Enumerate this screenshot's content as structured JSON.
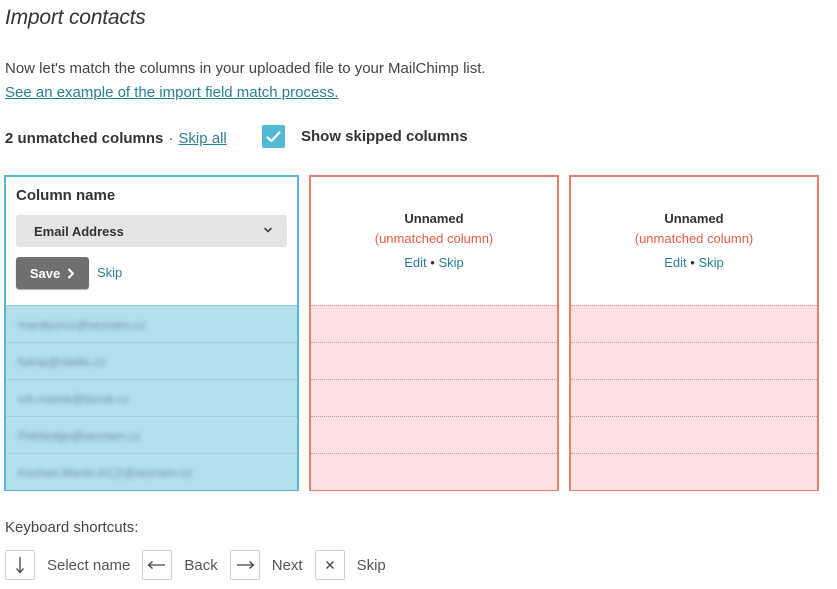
{
  "page": {
    "title": "Import contacts",
    "intro": "Now let's match the columns in your uploaded file to your MailChimp list.",
    "example_link": "See an example of the import field match process."
  },
  "summary": {
    "unmatched_count": "2 unmatched columns",
    "separator": "·",
    "skip_all": "Skip all",
    "show_skipped_label": "Show skipped columns",
    "show_skipped_checked": true
  },
  "colors": {
    "accent": "#52bad5",
    "unmatched_border": "#e37f6d",
    "unmatched_text": "#e85c41",
    "link": "#2a7f95",
    "save_button": "#707070"
  },
  "matching_column": {
    "label": "Column name",
    "selected_field": "Email Address",
    "save_label": "Save",
    "skip_label": "Skip",
    "rows": [
      "mardiyzrcz@seznam.cz",
      "fuimp@citello.cz",
      "mh.marek@tiscali.cz",
      "Petrilzdgo@seznam.cz",
      "Kochan.Martin.KCZ@seznam.cz"
    ]
  },
  "unmatched_columns": [
    {
      "name": "Unnamed",
      "note": "(unmatched column)",
      "edit_label": "Edit",
      "dot": "•",
      "skip_label": "Skip"
    },
    {
      "name": "Unnamed",
      "note": "(unmatched column)",
      "edit_label": "Edit",
      "dot": "•",
      "skip_label": "Skip"
    }
  ],
  "keyboard": {
    "title": "Keyboard shortcuts:",
    "shortcuts": [
      {
        "icon": "arrow-down-icon",
        "label": "Select name"
      },
      {
        "icon": "arrow-left-icon",
        "label": "Back"
      },
      {
        "icon": "arrow-right-icon",
        "label": "Next"
      },
      {
        "icon": "close-icon",
        "label": "Skip"
      }
    ]
  }
}
